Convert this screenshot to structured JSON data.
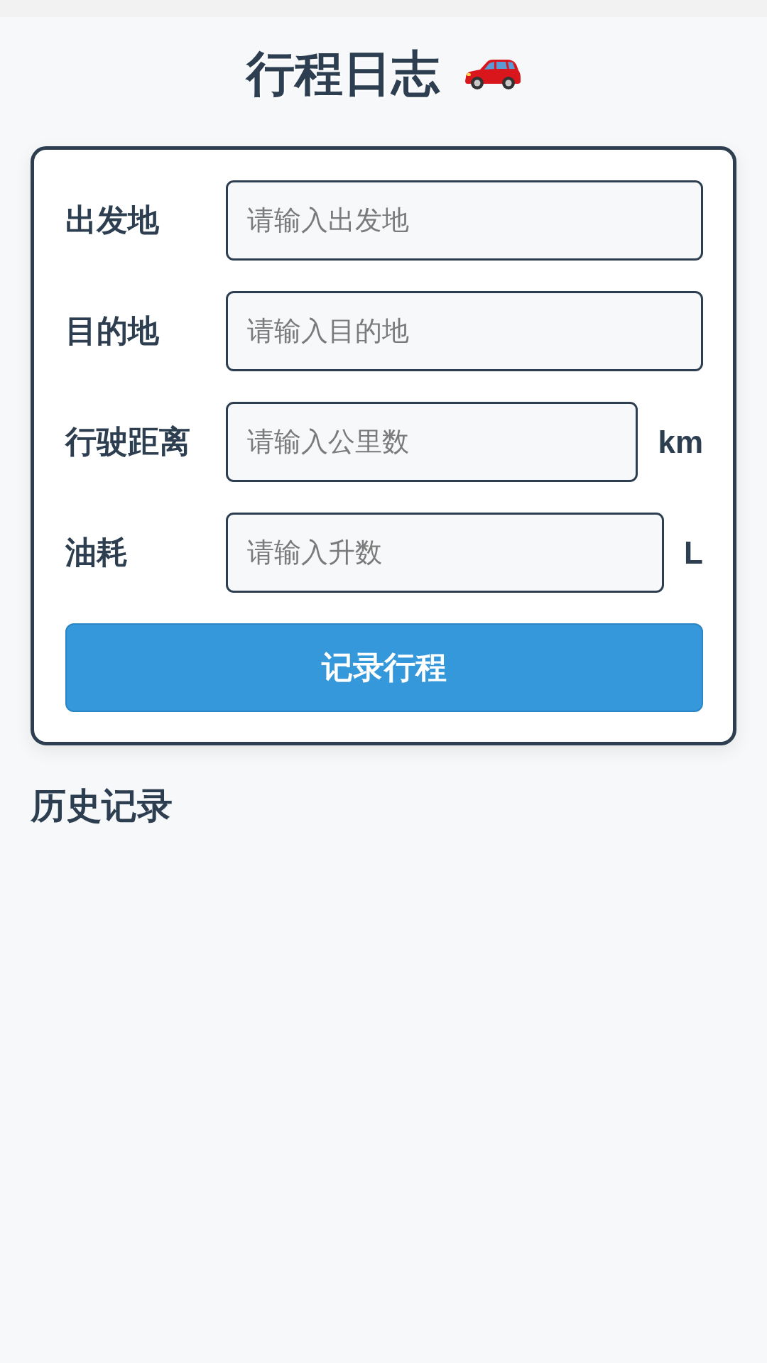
{
  "title": "行程日志",
  "form": {
    "fields": [
      {
        "label": "出发地",
        "placeholder": "请输入出发地"
      },
      {
        "label": "目的地",
        "placeholder": "请输入目的地"
      },
      {
        "label": "行驶距离",
        "placeholder": "请输入公里数",
        "unit": "km"
      },
      {
        "label": "油耗",
        "placeholder": "请输入升数",
        "unit": "L"
      }
    ],
    "submit_button": "记录行程"
  },
  "history": {
    "heading": "历史记录"
  }
}
